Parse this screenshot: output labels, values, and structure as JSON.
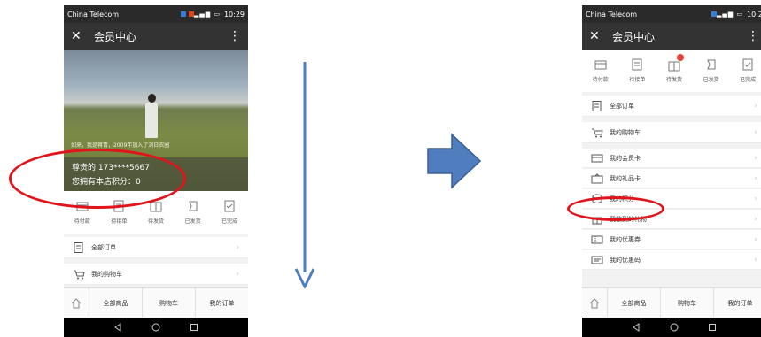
{
  "status_bar": {
    "carrier": "China Telecom",
    "time_left": "10:29",
    "time_right": "10:2"
  },
  "header": {
    "close_glyph": "✕",
    "title": "会员中心",
    "more_glyph": "⋮"
  },
  "profile": {
    "caption": "如来，我是蒋青，2009年加入了浏日衣圈",
    "name_line": "尊贵的 173****5667",
    "points_line": "您拥有本店积分：0"
  },
  "order_status": [
    {
      "label": "待付款",
      "icon": "wallet-icon"
    },
    {
      "label": "待接单",
      "icon": "list-icon"
    },
    {
      "label": "待发货",
      "icon": "package-icon"
    },
    {
      "label": "已发货",
      "icon": "shipped-icon"
    },
    {
      "label": "已完成",
      "icon": "check-icon"
    }
  ],
  "menu_left": [
    {
      "label": "全部订单",
      "icon": "orders-icon"
    },
    {
      "label": "我的购物车",
      "icon": "cart-icon"
    }
  ],
  "menu_right": [
    {
      "label": "全部订单",
      "icon": "orders-icon"
    },
    {
      "label": "我的购物车",
      "icon": "cart-icon"
    },
    {
      "label": "我的会员卡",
      "icon": "card-icon"
    },
    {
      "label": "我的礼品卡",
      "icon": "gift-card-icon"
    },
    {
      "label": "我的积分",
      "icon": "points-icon"
    },
    {
      "label": "我收到的礼物",
      "icon": "gift-icon"
    },
    {
      "label": "我的优惠券",
      "icon": "coupon-icon"
    },
    {
      "label": "我的优惠码",
      "icon": "promo-code-icon"
    }
  ],
  "tab_bar": {
    "home_icon": "home-icon",
    "tabs": [
      "全部商品",
      "购物车",
      "我的订单"
    ]
  },
  "nav_bar": {
    "buttons": [
      "back-icon",
      "home-circle-icon",
      "recents-icon"
    ]
  },
  "colors": {
    "header_bg": "#333333",
    "highlight_red": "#e0151b",
    "arrow_blue": "#4f7dbd",
    "badge_red": "#e6443a"
  }
}
